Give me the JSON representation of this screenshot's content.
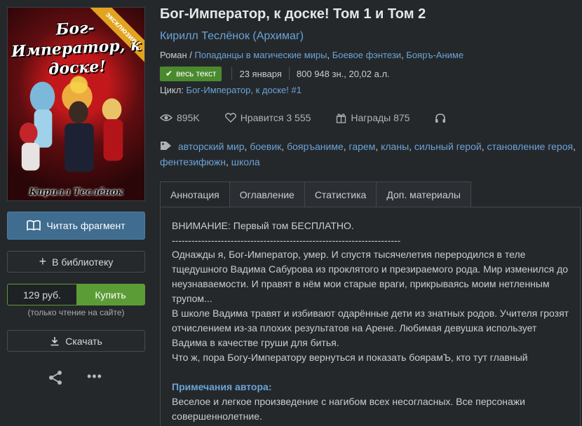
{
  "cover": {
    "title_art": "Бог-Император, к доске!",
    "author_art": "Кирилл Теслёнок",
    "ribbon": "эксклюзив"
  },
  "actions": {
    "read_label": "Читать фрагмент",
    "library_label": "В библиотеку",
    "price": "129 руб.",
    "buy_label": "Купить",
    "buy_note": "(только чтение на сайте)",
    "download_label": "Скачать"
  },
  "book": {
    "title": "Бог-Император, к доске! Том 1 и Том 2",
    "author": "Кирилл Теслёнок (Архимаг)",
    "genre_prefix": "Роман / ",
    "genres": [
      "Попаданцы в магические миры",
      "Боевое фэнтези",
      "Бояръ-Аниме"
    ],
    "status_badge": "весь текст",
    "date": "23 января",
    "size": "800 948 зн., 20,02 а.л.",
    "cycle_label": "Цикл: ",
    "cycle_name": "Бог-Император, к доске! #1",
    "views": "895K",
    "likes": "Нравится 3 555",
    "awards": "Награды 875",
    "tags": [
      "авторский мир",
      "боевик",
      "бояръаниме",
      "гарем",
      "кланы",
      "сильный герой",
      "становление героя",
      "фентезифюжн",
      "школа"
    ]
  },
  "tabs": [
    "Аннотация",
    "Оглавление",
    "Статистика",
    "Доп. материалы"
  ],
  "annotation": {
    "warning": "ВНИМАНИЕ: Первый том БЕСПЛАТНО.",
    "divider": "----------------------------------------------------------------------",
    "p1": "Однажды я, Бог-Император, умер. И спустя тысячелетия переродился в теле тщедушного Вадима Сабурова из проклятого и презираемого рода. Мир изменился до неузнаваемости. И правят в нём мои старые враги, прикрываясь моим нетленным трупом...",
    "p2": "В школе Вадима травят и избивают одарённые дети из знатных родов. Учителя грозят отчислением из-за плохих результатов на Арене. Любимая девушка использует Вадима в качестве груши для битья.",
    "p3": "Что ж, пора Богу-Императору вернуться и показать боярамЪ, кто тут главный",
    "notes_heading": "Примечания автора:",
    "notes": "Веселое и легкое произведение с нагибом всех несогласных. Все персонажи совершеннолетние."
  },
  "colors": {
    "accent": "#6aa4d8",
    "buy": "#5c9c37",
    "read": "#3f6c8f",
    "badge": "#4a8a2f"
  }
}
